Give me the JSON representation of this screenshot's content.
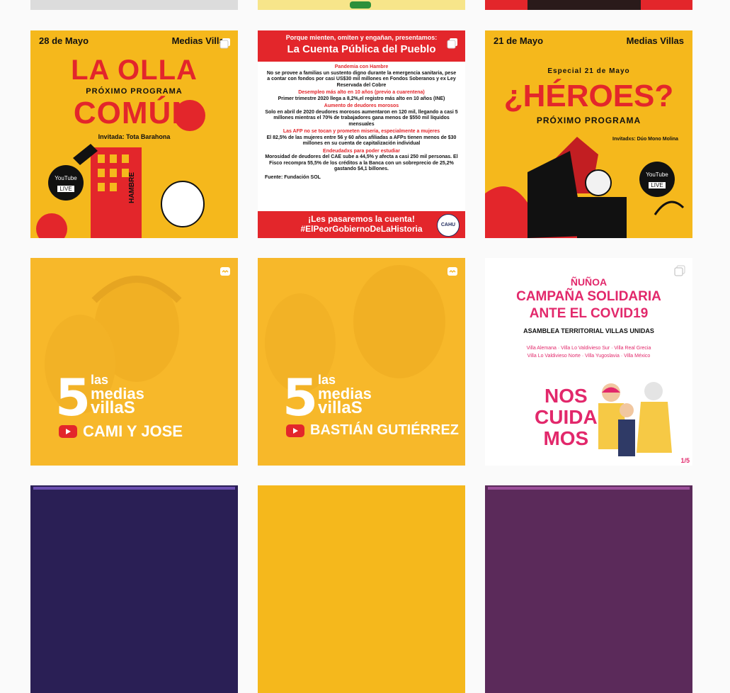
{
  "grid": {
    "posts": [
      {
        "ribbon_left": "28 de Mayo",
        "ribbon_right": "Medias Villas",
        "title_a": "LA OLLA",
        "subtitle": "PRÓXIMO PROGRAMA",
        "title_b": "COMÚN",
        "guest": "Invitada: Tota Barahona",
        "building_word": "HAMBRE",
        "yt": "YouTube",
        "live": "LIVE"
      },
      {
        "header": "Porque mienten, omiten y engañan, presentamos:",
        "title": "La Cuenta Pública del Pueblo",
        "s1_title": "Pandemia con Hambre",
        "s1_text": "No se provee a familias un sustento digno durante la emergencia sanitaria, pese a contar con fondos por casi US$30 mil millones en Fondos Soberanos y ex Ley Reservada del Cobre",
        "s2_title": "Desempleo más alto en 10 años (previo a cuarentena)",
        "s2_text": "Primer trimestre 2020 llega a 8,2%,el registro más alto en 10 años (INE)",
        "s3_title": "Aumento de deudores morosos",
        "s3_text": "Solo en abril de 2020 deudores morosos aumentaron en 120 mil, llegando a casi 5 millones mientras el 70% de trabajadores gana menos de $550 mil líquidos mensuales",
        "s4_title": "Las AFP no se tocan y prometen miseria, especialmente a mujeres",
        "s4_text": "El 82,5% de las mujeres entre 56 y 60 años afiliadas a AFPs tienen menos de $30 millones en su cuenta de capitalización individual",
        "s5_title": "Endeudadxs para poder estudiar",
        "s5_text": "Morosidad de deudores del CAE sube a 44,5% y afecta a casi 250 mil personas. El Fisco recompra 55,5% de los créditos a la Banca con un sobreprecio de 25,2% gastando $4,1 billones.",
        "source": "Fuente: Fundación SOL",
        "footer1": "¡Les pasaremos la cuenta!",
        "footer2": "#ElPeorGobiernoDeLaHistoria",
        "seal": "CAHU"
      },
      {
        "ribbon_left": "21 de Mayo",
        "ribbon_right": "Medias Villas",
        "special": "Especial 21 de Mayo",
        "title": "¿HÉROES?",
        "subtitle": "PRÓXIMO PROGRAMA",
        "guest": "Invitadxs: Dúo Mono Molina",
        "yt": "YouTube",
        "live": "LIVE"
      },
      {
        "num": "5",
        "brand1": "las",
        "brand2": "medias",
        "brand3": "villaS",
        "caption": "CAMI Y JOSE"
      },
      {
        "num": "5",
        "brand1": "las",
        "brand2": "medias",
        "brand3": "villaS",
        "caption": "BASTIÁN GUTIÉRREZ"
      },
      {
        "place": "ÑUÑOA",
        "line1": "CAMPAÑA SOLIDARIA",
        "line2": "ANTE EL COVID19",
        "org": "ASAMBLEA TERRITORIAL VILLAS UNIDAS",
        "villas1": "Villa Alemana · Villa Lo Valdivieso Sur · Villa Real Grecia",
        "villas2": "Villa Lo Valdivieso Norte · Villa Yugoslavia · Villa México",
        "cuid1": "NOS",
        "cuid2": "CUIDA",
        "cuid3": "MOS",
        "page": "1/5"
      }
    ]
  },
  "colors": {
    "yellow": "#f5b81c",
    "red": "#e3262b",
    "dark": "#1a1a1a",
    "promo_yellow": "#f7b82a",
    "navy": "#1f2b5e",
    "green": "#2c8f3a",
    "pink": "#e2286b"
  }
}
